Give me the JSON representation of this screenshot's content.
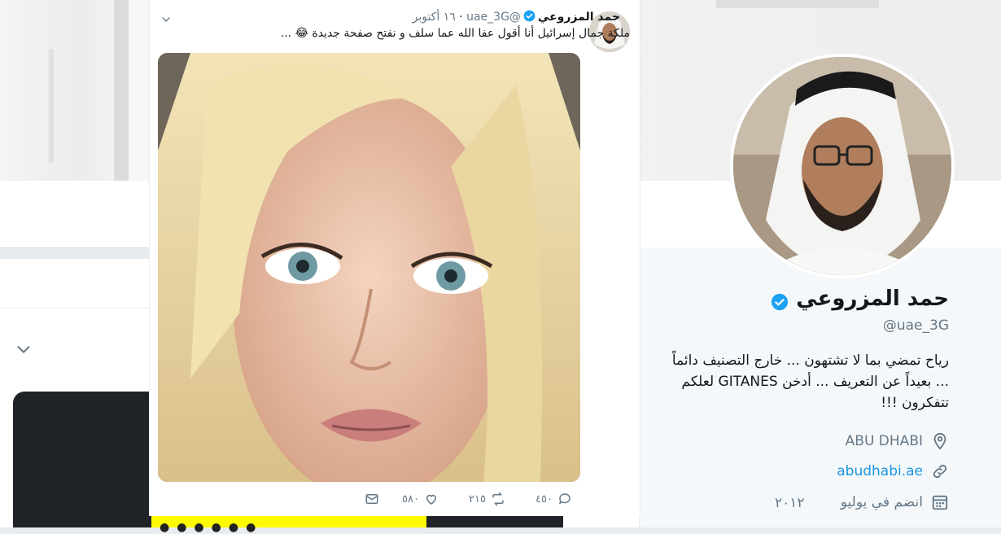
{
  "profile": {
    "name": "حمد المزروعي",
    "handle": "@uae_3G",
    "bio": "رياح تمضي بما لا تشتهون ... خارج التصنيف دائماً ... بعيداً عن التعريف ... أدخن GITANES لعلكم تتفكرون !!!",
    "location": "ABU DHABI",
    "website": "abudhabi.ae",
    "joined_label": "انضم في يوليو",
    "joined_year": "٢٠١٢",
    "icons": {
      "location": "location-pin-icon",
      "website": "link-icon",
      "joined": "calendar-icon",
      "verified": "verified-badge-icon"
    }
  },
  "tweet": {
    "author_name": "حمد المزروعي",
    "author_handle": "@uae_3G",
    "time": "١٦ أكتوبر",
    "text": "ملكة جمال إسرائيل أنا أقول عفا الله عما سلف و نفتح صفحة جديدة 😂 ...",
    "actions": {
      "reply": "٤٥٠",
      "retweet": "٢١٥",
      "like": "٥٨٠"
    }
  },
  "colors": {
    "accent": "#1da1f2",
    "link": "#1b95e0",
    "muted": "#657786",
    "text": "#14171a"
  }
}
